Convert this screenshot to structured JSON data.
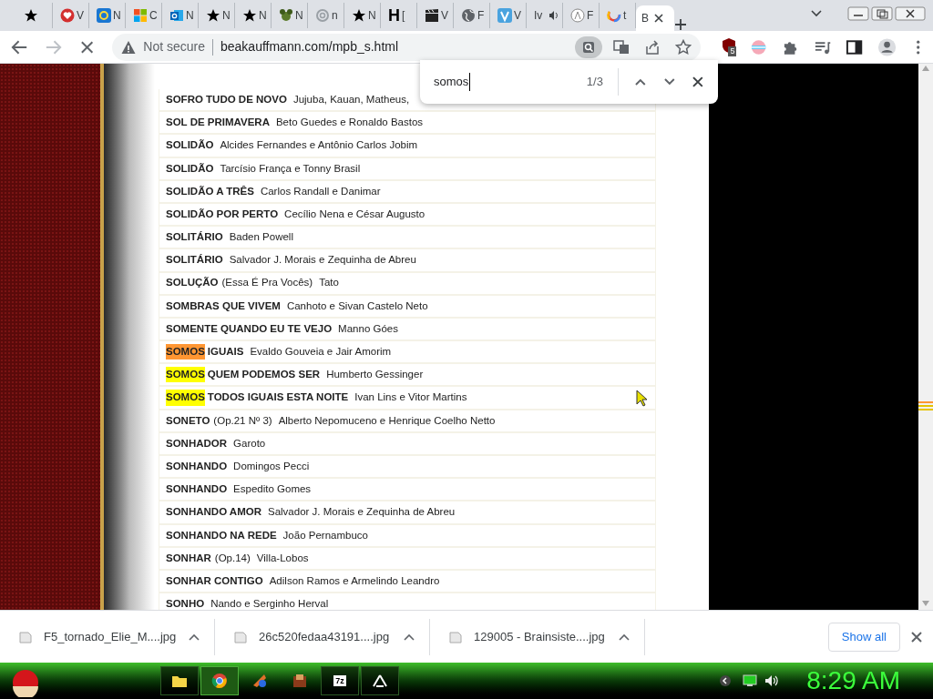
{
  "tabs": [
    {
      "selected": false
    },
    {
      "label": "V",
      "selected": false
    },
    {
      "label": "N",
      "selected": false
    },
    {
      "label": "C",
      "selected": false
    },
    {
      "label": "N",
      "selected": false
    },
    {
      "label": "N",
      "selected": false
    },
    {
      "label": "N",
      "selected": false
    },
    {
      "label": "N",
      "selected": false
    },
    {
      "label": "n",
      "selected": false
    },
    {
      "label": "N",
      "selected": false
    },
    {
      "badge": "H",
      "label": "[",
      "selected": false
    },
    {
      "label": "V",
      "selected": false
    },
    {
      "label": "F",
      "selected": false
    },
    {
      "label": "V",
      "selected": false
    },
    {
      "label": "Iv",
      "audio": true,
      "selected": false
    },
    {
      "label": "F",
      "selected": false
    },
    {
      "label": "t",
      "selected": false
    },
    {
      "label": "B",
      "selected": true
    }
  ],
  "toolbar": {
    "security": "Not secure",
    "url": "beakauffmann.com/mpb_s.html",
    "extension_badge": "5"
  },
  "find_bar": {
    "value": "somos",
    "count": "1/3"
  },
  "songs": [
    {
      "title": "SOFRO TUDO DE NOVO",
      "artist": "Jujuba, Kauan, Matheus,"
    },
    {
      "title": "SOL DE PRIMAVERA",
      "artist": "Beto Guedes e Ronaldo Bastos"
    },
    {
      "title": "SOLIDÃO",
      "artist": "Alcides Fernandes e Antônio Carlos Jobim"
    },
    {
      "title": "SOLIDÃO",
      "artist": "Tarcísio França e Tonny Brasil"
    },
    {
      "title": "SOLIDÃO A TRÊS",
      "artist": "Carlos Randall e Danimar"
    },
    {
      "title": "SOLIDÃO POR PERTO",
      "artist": "Cecílio Nena e César Augusto"
    },
    {
      "title": "SOLITÁRIO",
      "artist": "Baden Powell"
    },
    {
      "title": "SOLITÁRIO",
      "artist": "Salvador J. Morais e Zequinha de Abreu"
    },
    {
      "title": "SOLUÇÃO",
      "note": "(Essa É Pra Vocês)",
      "artist": "Tato"
    },
    {
      "title": "SOMBRAS QUE VIVEM",
      "artist": "Canhoto e Sivan Castelo Neto"
    },
    {
      "title": "SOMENTE QUANDO EU TE VEJO",
      "artist": "Manno Góes"
    },
    {
      "match": "SOMOS",
      "match_active": true,
      "title": "IGUAIS",
      "artist": "Evaldo Gouveia e Jair Amorim"
    },
    {
      "match": "SOMOS",
      "match_active": false,
      "title": "QUEM PODEMOS SER",
      "artist": "Humberto Gessinger"
    },
    {
      "match": "SOMOS",
      "match_active": false,
      "title": "TODOS IGUAIS ESTA NOITE",
      "artist": "Ivan Lins e Vitor Martins"
    },
    {
      "title": "SONETO",
      "note": "(Op.21 Nº 3)",
      "artist": "Alberto Nepomuceno e Henrique Coelho Netto"
    },
    {
      "title": "SONHADOR",
      "artist": "Garoto"
    },
    {
      "title": "SONHANDO",
      "artist": "Domingos Pecci"
    },
    {
      "title": "SONHANDO",
      "artist": "Espedito Gomes"
    },
    {
      "title": "SONHANDO AMOR",
      "artist": "Salvador J. Morais e Zequinha de Abreu"
    },
    {
      "title": "SONHANDO NA REDE",
      "artist": "João Pernambuco"
    },
    {
      "title": "SONHAR",
      "note": "(Op.14)",
      "artist": "Villa-Lobos"
    },
    {
      "title": "SONHAR CONTIGO",
      "artist": "Adilson Ramos e Armelindo Leandro"
    },
    {
      "title": "SONHO",
      "artist": "Nando e Serginho Herval"
    }
  ],
  "downloads": {
    "items": [
      {
        "name": "F5_tornado_Elie_M....jpg"
      },
      {
        "name": "26c520fedaa43191....jpg"
      },
      {
        "name": "129005 - Brainsiste....jpg"
      }
    ],
    "show_all": "Show all"
  },
  "taskbar": {
    "archiver_label": "7z",
    "clock": "8:29 AM"
  }
}
